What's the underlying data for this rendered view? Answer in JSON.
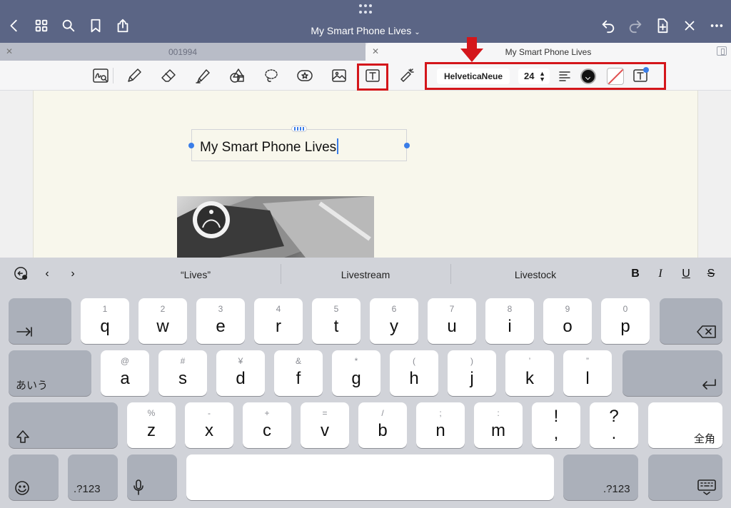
{
  "nav": {
    "document_title": "My Smart Phone Lives",
    "icons": [
      "back-icon",
      "grid-icon",
      "search-icon",
      "bookmark-icon",
      "share-icon",
      "undo-icon",
      "redo-icon",
      "new-page-icon",
      "close-icon",
      "more-icon"
    ]
  },
  "tabs": [
    {
      "label": "001994",
      "active": false
    },
    {
      "label": "My Smart Phone Lives",
      "active": true
    }
  ],
  "toolbar": {
    "tools": [
      "handwriting-search-icon",
      "pen-icon",
      "eraser-icon",
      "highlighter-icon",
      "shapes-icon",
      "lasso-icon",
      "sticker-icon",
      "image-icon",
      "text-tool-icon",
      "laser-pointer-icon"
    ],
    "active_tool": "text-tool-icon",
    "font_name": "HelveticaNeue",
    "font_size": "24",
    "text_color": "#111111",
    "highlight_color": "#d4161b"
  },
  "document": {
    "text_box_content": "My Smart Phone Lives"
  },
  "keyboard": {
    "suggestions": [
      "“Lives”",
      "Livestream",
      "Livestock"
    ],
    "format_buttons": [
      "B",
      "I",
      "U",
      "S"
    ],
    "row1": [
      {
        "main": "q",
        "alt": "1"
      },
      {
        "main": "w",
        "alt": "2"
      },
      {
        "main": "e",
        "alt": "3"
      },
      {
        "main": "r",
        "alt": "4"
      },
      {
        "main": "t",
        "alt": "5"
      },
      {
        "main": "y",
        "alt": "6"
      },
      {
        "main": "u",
        "alt": "7"
      },
      {
        "main": "i",
        "alt": "8"
      },
      {
        "main": "o",
        "alt": "9"
      },
      {
        "main": "p",
        "alt": "0"
      }
    ],
    "row2": [
      {
        "main": "a",
        "alt": "@"
      },
      {
        "main": "s",
        "alt": "#"
      },
      {
        "main": "d",
        "alt": "¥"
      },
      {
        "main": "f",
        "alt": "&"
      },
      {
        "main": "g",
        "alt": "*"
      },
      {
        "main": "h",
        "alt": "("
      },
      {
        "main": "j",
        "alt": ")"
      },
      {
        "main": "k",
        "alt": "’"
      },
      {
        "main": "l",
        "alt": "”"
      }
    ],
    "row3": [
      {
        "main": "z",
        "alt": "%"
      },
      {
        "main": "x",
        "alt": "-"
      },
      {
        "main": "c",
        "alt": "+"
      },
      {
        "main": "v",
        "alt": "="
      },
      {
        "main": "b",
        "alt": "/"
      },
      {
        "main": "n",
        "alt": ";"
      },
      {
        "main": "m",
        "alt": ":"
      },
      {
        "main": "!",
        "alt": ","
      },
      {
        "main": "?",
        "alt": "."
      }
    ],
    "kana_key": "あいう",
    "zenkaku_key": "全角",
    "numbers_key": ".?123"
  }
}
